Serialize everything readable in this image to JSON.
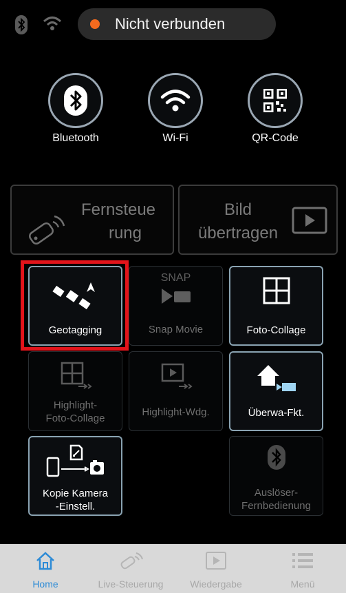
{
  "status": {
    "connection_text": "Nicht verbunden",
    "dot_color": "#f36a1e"
  },
  "connect": [
    {
      "label": "Bluetooth",
      "icon": "bluetooth-icon"
    },
    {
      "label": "Wi-Fi",
      "icon": "wifi-icon"
    },
    {
      "label": "QR-Code",
      "icon": "qr-code-icon"
    }
  ],
  "big_buttons": {
    "remote": {
      "line1": "Fernsteue",
      "line2": "rung",
      "icon": "remote-icon",
      "enabled": false
    },
    "transfer": {
      "line1": "Bild",
      "line2": "übertragen",
      "icon": "play-screen-icon",
      "enabled": false
    }
  },
  "tiles": {
    "geotagging": {
      "label": "Geotagging",
      "enabled": true
    },
    "snap_movie": {
      "label": "Snap Movie",
      "badge": "SNAP",
      "enabled": false
    },
    "foto_collage": {
      "label": "Foto-Collage",
      "enabled": true
    },
    "highlight_collage": {
      "line1": "Highlight-",
      "line2": "Foto-Collage",
      "enabled": false
    },
    "highlight_wdg": {
      "label": "Highlight-Wdg.",
      "enabled": false
    },
    "ueberwa": {
      "label": "Überwa-Fkt.",
      "enabled": true
    },
    "kopie": {
      "line1": "Kopie Kamera",
      "line2": "-Einstell.",
      "enabled": true
    },
    "ausloeser": {
      "line1": "Auslöser-",
      "line2": "Fernbedienung",
      "enabled": false
    }
  },
  "nav": [
    {
      "label": "Home",
      "icon": "home-icon",
      "active": true
    },
    {
      "label": "Live-Steuerung",
      "icon": "remote-icon",
      "active": false
    },
    {
      "label": "Wiedergabe",
      "icon": "playback-icon",
      "active": false
    },
    {
      "label": "Menü",
      "icon": "menu-icon",
      "active": false
    }
  ],
  "colors": {
    "accent": "#2d8bd6",
    "highlight": "#e2141b",
    "tile_border": "#8aa3b2"
  }
}
